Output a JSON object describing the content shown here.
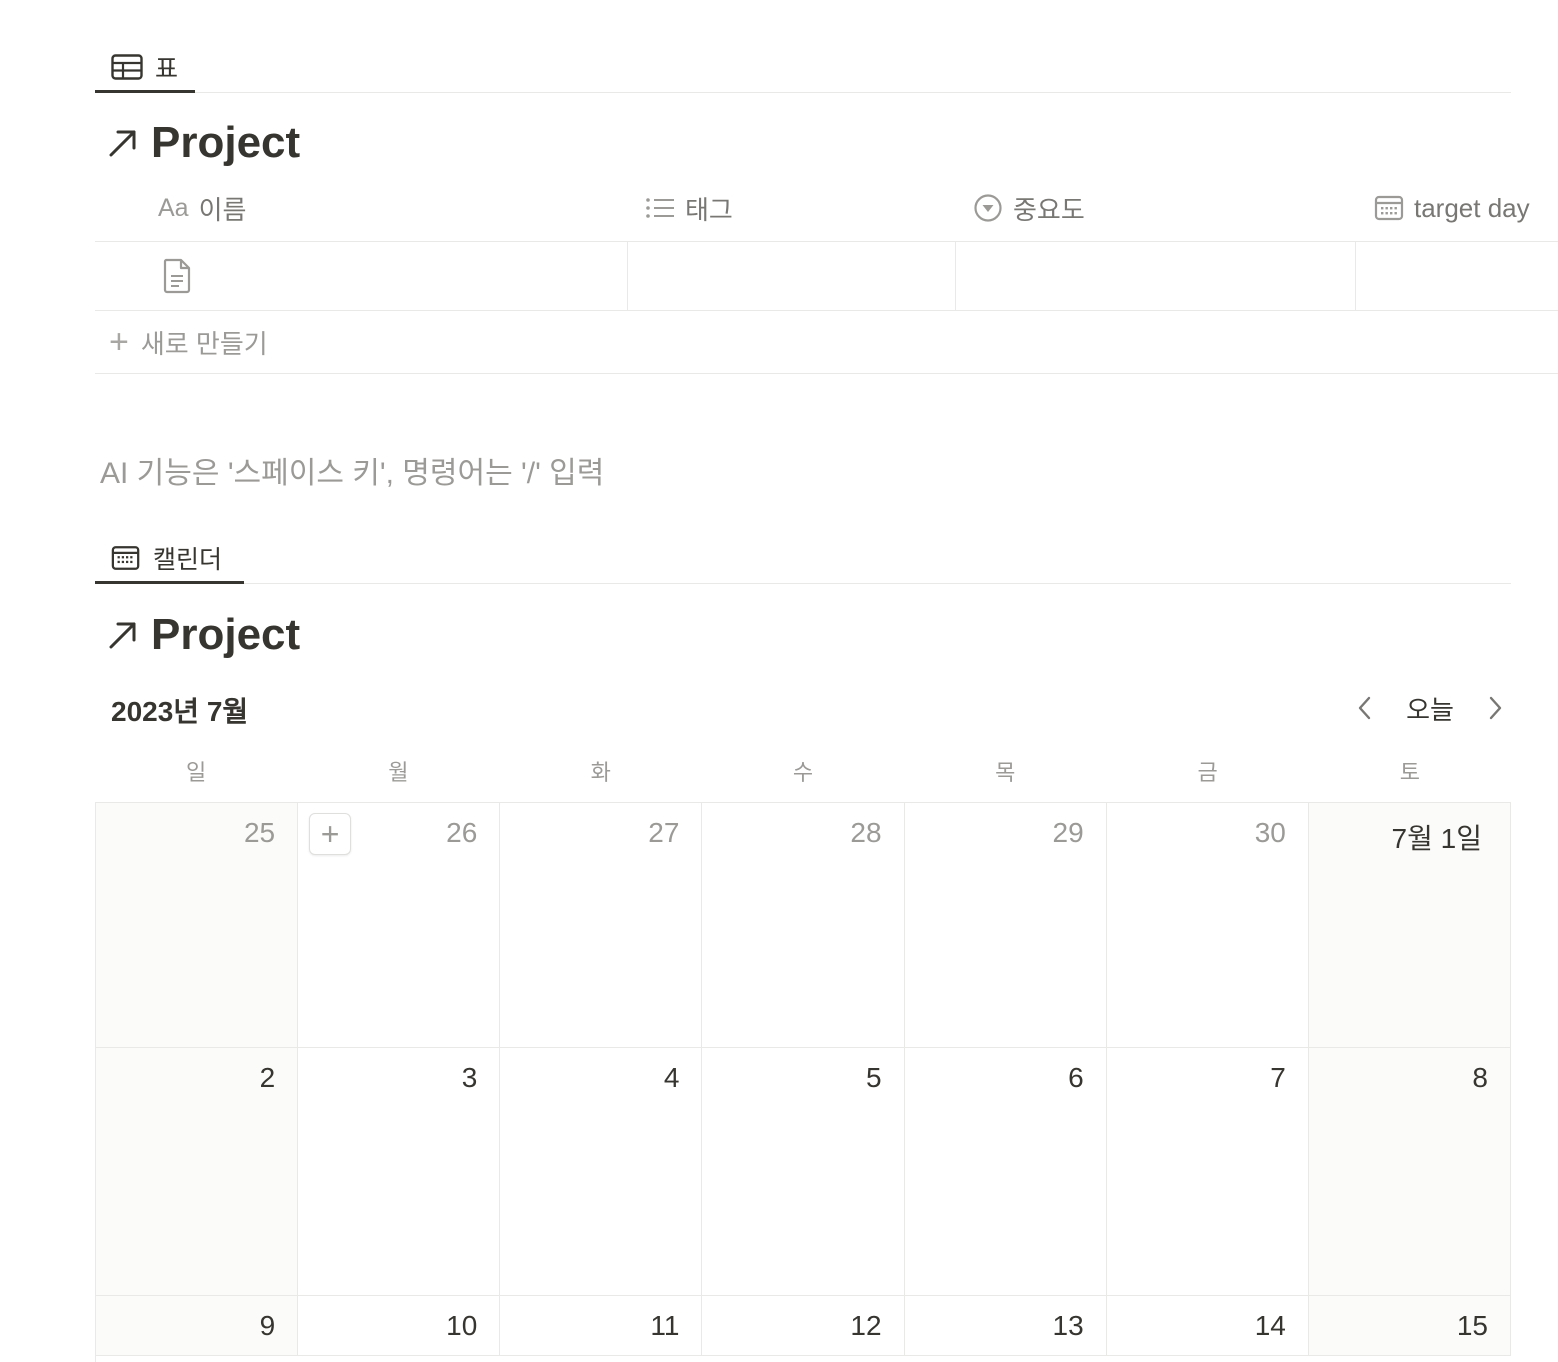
{
  "table_view": {
    "tab_label": "표",
    "db_title": "Project",
    "columns": [
      {
        "icon": "Aa",
        "label": "이름"
      },
      {
        "icon": "list-icon",
        "label": "태그"
      },
      {
        "icon": "select-icon",
        "label": "중요도"
      },
      {
        "icon": "calendar-icon",
        "label": "target day"
      }
    ],
    "new_row_label": "새로 만들기"
  },
  "editor_placeholder": "AI 기능은 '스페이스 키', 명령어는 '/' 입력",
  "calendar_view": {
    "tab_label": "캘린더",
    "db_title": "Project",
    "month_label": "2023년 7월",
    "today_label": "오늘",
    "weekdays": [
      "일",
      "월",
      "화",
      "수",
      "목",
      "금",
      "토"
    ],
    "weeks": [
      [
        "25",
        "26",
        "27",
        "28",
        "29",
        "30",
        "7월 1일"
      ],
      [
        "2",
        "3",
        "4",
        "5",
        "6",
        "7",
        "8"
      ],
      [
        "9",
        "10",
        "11",
        "12",
        "13",
        "14",
        "15"
      ]
    ]
  }
}
